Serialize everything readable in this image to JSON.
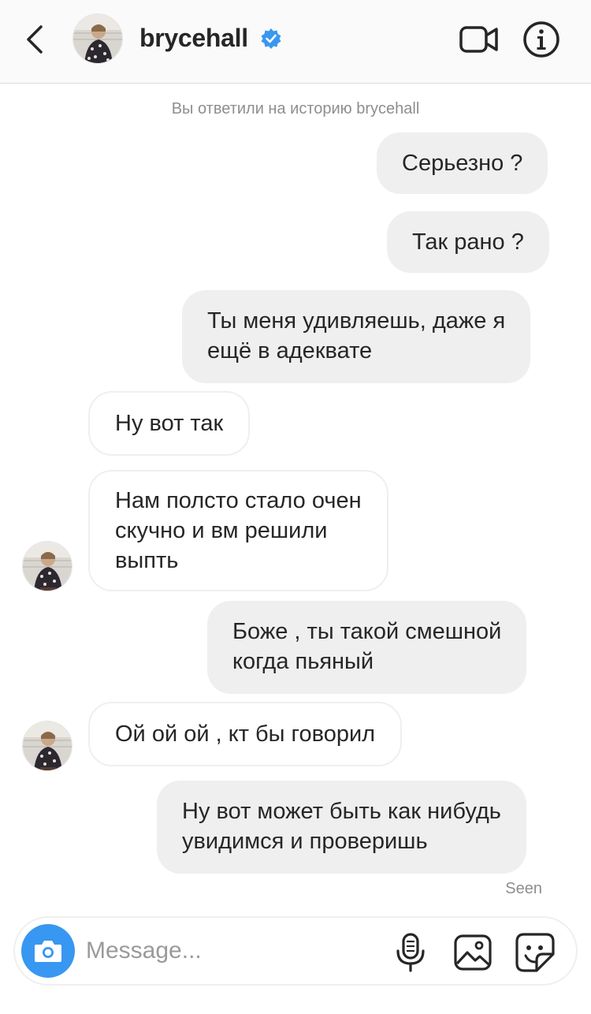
{
  "header": {
    "username": "brycehall",
    "verified": true,
    "icons": {
      "back": "chevron-left-icon",
      "video": "video-camera-icon",
      "info": "info-icon"
    }
  },
  "chat": {
    "system_note": "Вы ответили на историю brycehall",
    "messages": [
      {
        "direction": "outgoing",
        "text": "Серьезно ?"
      },
      {
        "direction": "outgoing",
        "text": "Так рано ?"
      },
      {
        "direction": "outgoing",
        "lines": [
          "Ты меня удивляешь, даже я",
          "ещё в адеквате"
        ]
      },
      {
        "direction": "incoming",
        "text": "Ну вот так"
      },
      {
        "direction": "incoming",
        "lines": [
          "Нам полсто стало очен",
          "скучно и вм решили",
          "выпть"
        ]
      },
      {
        "direction": "outgoing",
        "lines": [
          "Боже , ты такой смешной",
          "когда пьяный"
        ]
      },
      {
        "direction": "incoming",
        "text": "Ой ой ой , кт бы говорил"
      },
      {
        "direction": "outgoing",
        "lines": [
          "Ну вот может быть как нибудь",
          "увидимся и проверишь"
        ]
      }
    ],
    "seen_label": "Seen"
  },
  "composer": {
    "placeholder": "Message...",
    "icons": [
      "camera-icon",
      "microphone-icon",
      "gallery-icon",
      "sticker-icon"
    ]
  },
  "colors": {
    "accent": "#3897f0",
    "verified_badge": "#3897f0",
    "outgoing_bubble": "#efefef",
    "incoming_border": "#efefef",
    "muted_text": "#8e8e8e"
  }
}
